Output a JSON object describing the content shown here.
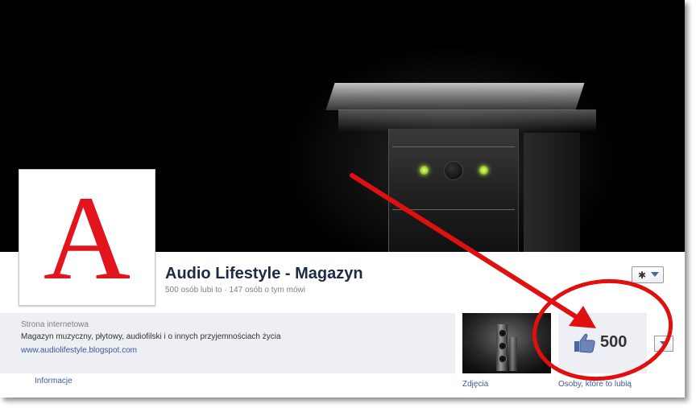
{
  "page": {
    "name": "Audio Lifestyle - Magazyn",
    "stats": "500 osób lubi to · 147 osób o tym mówi",
    "logo_letter": "A"
  },
  "about": {
    "label": "Strona internetowa",
    "description": "Magazyn muzyczny, płytowy, audiofilski i o innych przyjemnościach życia",
    "website": "www.audiolifestyle.blogspot.com"
  },
  "tabs": {
    "info": "Informacje",
    "photos": "Zdjęcia",
    "likes_label": "Osoby, które to lubią"
  },
  "likes": {
    "count": "500"
  },
  "colors": {
    "brand_red": "#e2141c",
    "link_blue": "#3b5998",
    "annotation_red": "#e01010",
    "panel_bg": "#edeff4"
  },
  "icons": {
    "settings": "gear-icon",
    "like": "thumbs-up-icon",
    "dropdown": "chevron-down-icon"
  }
}
